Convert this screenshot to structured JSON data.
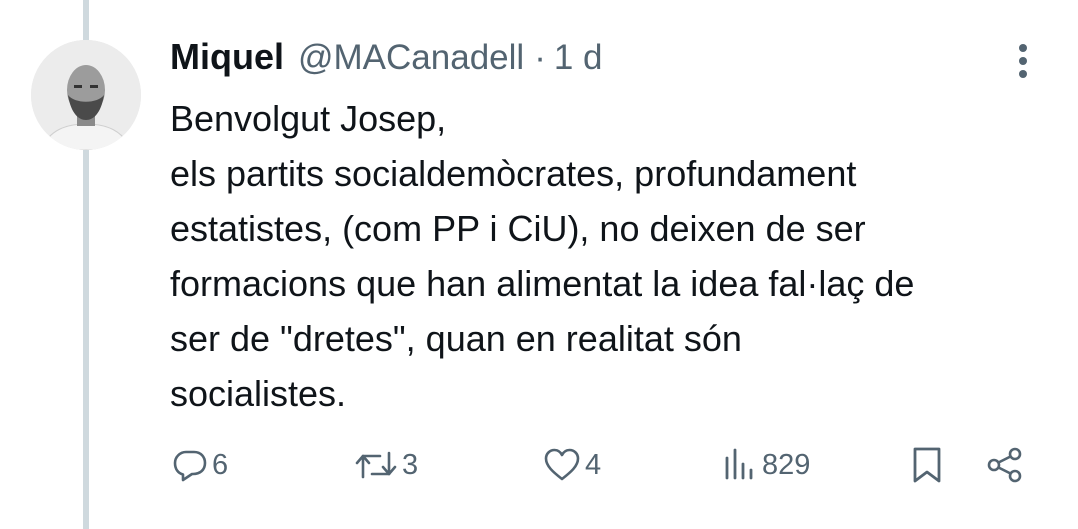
{
  "tweet": {
    "author_name": "Miquel",
    "author_handle": "@MACanadell",
    "separator": "·",
    "time": "1 d",
    "text_lines": [
      "Benvolgut Josep,",
      "els partits socialdemòcrates, profundament",
      "estatistes, (com PP i CiU), no deixen de ser",
      "formacions que han alimentat la idea fal·laç de",
      "ser de \"dretes\", quan en realitat són",
      "socialistes."
    ]
  },
  "actions": {
    "replies": "6",
    "retweets": "3",
    "likes": "4",
    "views": "829"
  },
  "icons": {
    "more": "more-vertical-icon",
    "reply": "reply-icon",
    "retweet": "retweet-icon",
    "like": "heart-icon",
    "views": "views-chart-icon",
    "bookmark": "bookmark-icon",
    "share": "share-icon"
  },
  "colors": {
    "text": "#0f1419",
    "secondary": "#536471",
    "thread_line": "#cfd9de",
    "background": "#ffffff"
  }
}
